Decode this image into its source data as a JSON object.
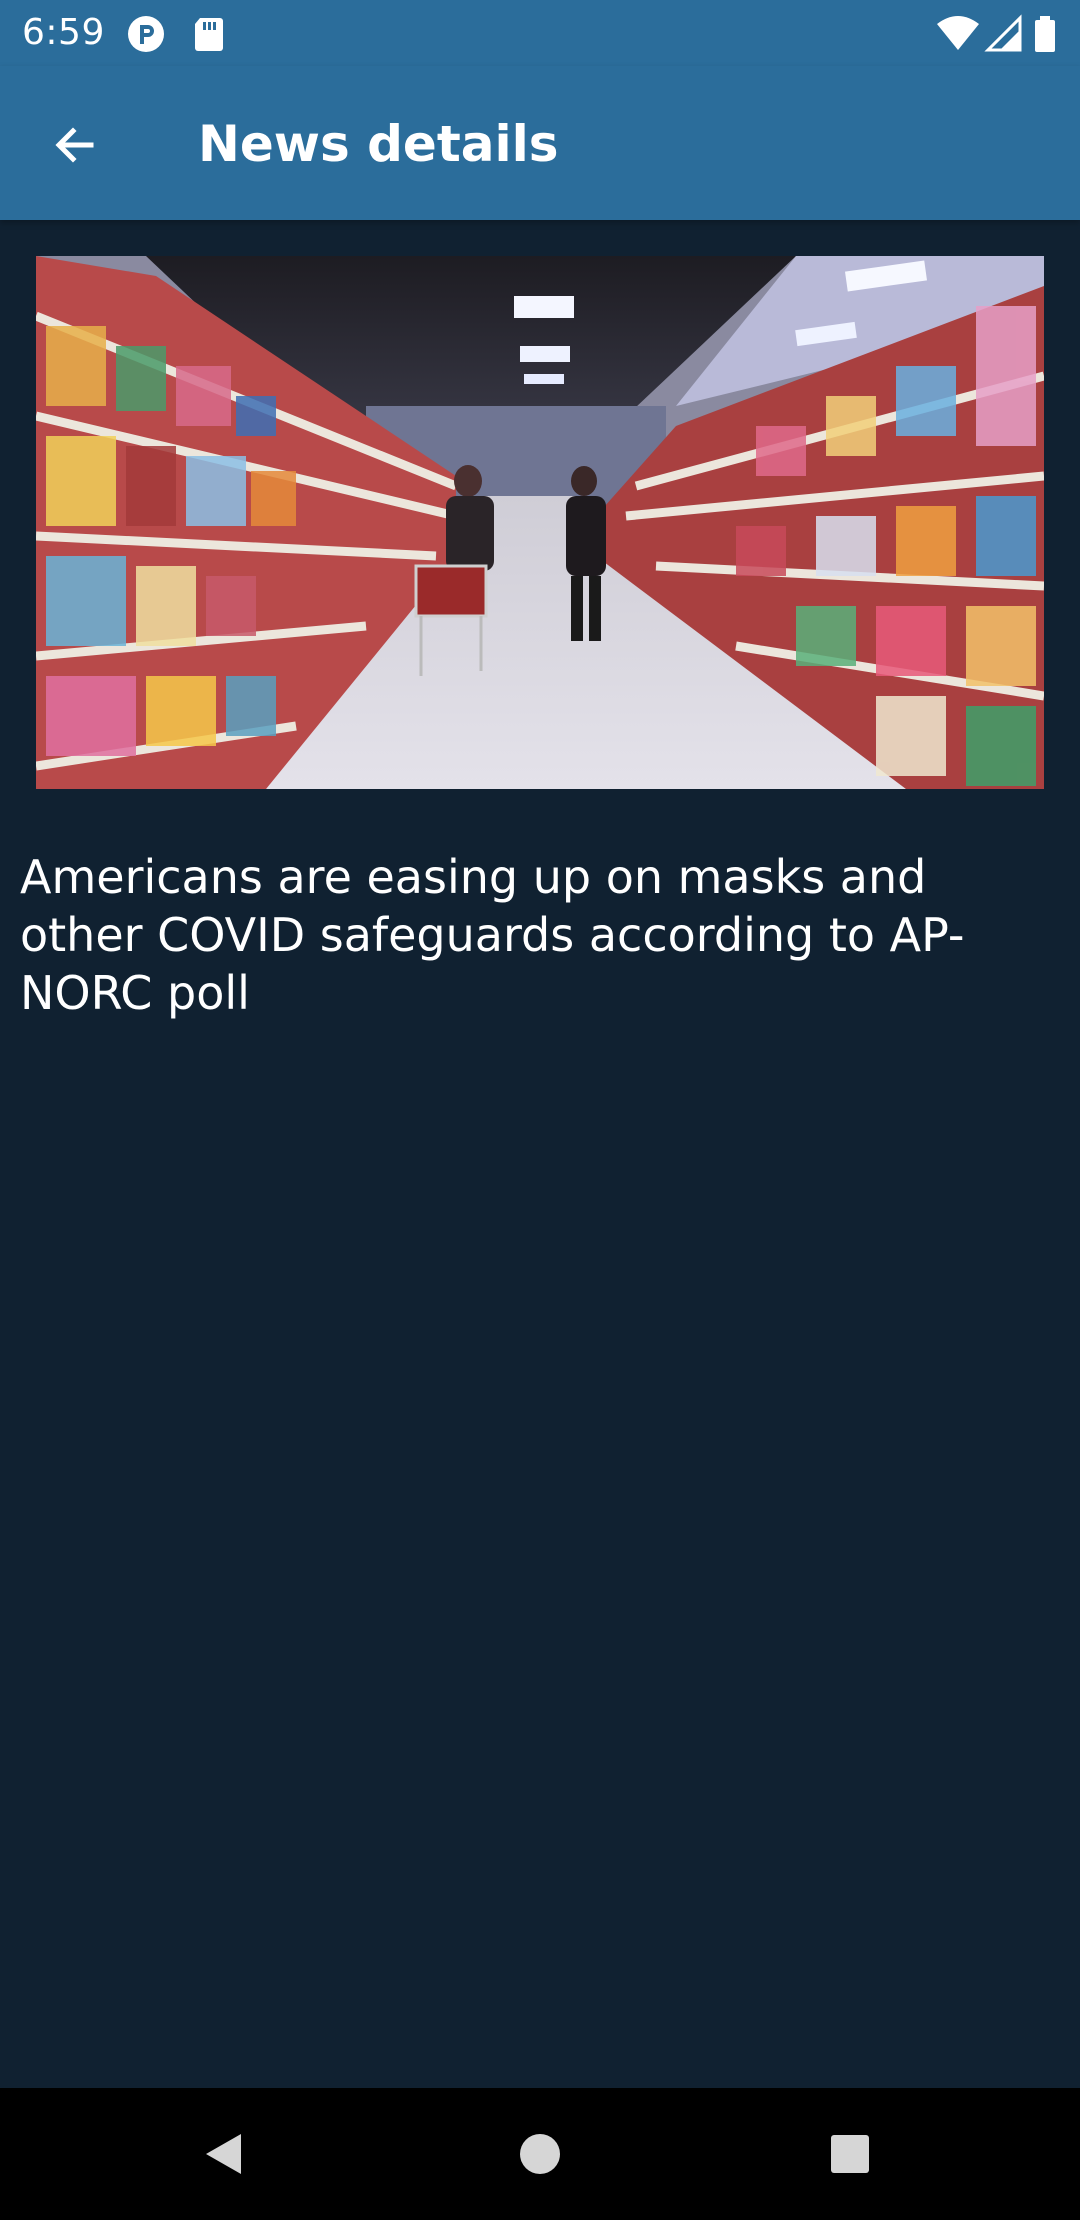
{
  "status_bar": {
    "time": "6:59",
    "icons": [
      "notification-p-icon",
      "sd-card-icon",
      "wifi-icon",
      "cellular-signal-icon",
      "battery-icon"
    ]
  },
  "app_bar": {
    "title": "News details",
    "back_icon": "arrow-back-icon"
  },
  "article": {
    "image": "grocery-store-aisle-photo",
    "headline": "Americans are easing up on masks and other COVID safeguards according to AP-NORC poll"
  },
  "nav_bar": {
    "icons": [
      "back-triangle-icon",
      "home-circle-icon",
      "recents-square-icon"
    ]
  },
  "colors": {
    "app_bar": "#2b6d9b",
    "background": "#102131",
    "nav_bar": "#000000",
    "text": "#ffffff"
  }
}
